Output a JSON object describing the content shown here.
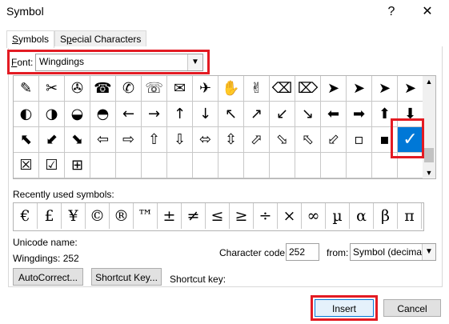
{
  "window": {
    "title": "Symbol",
    "help": "?",
    "close": "✕"
  },
  "tabs": [
    {
      "pre": "",
      "u": "S",
      "post": "ymbols"
    },
    {
      "pre": "S",
      "u": "p",
      "post": "ecial Characters"
    }
  ],
  "font": {
    "label_u": "F",
    "label_rest": "ont:",
    "value": "Wingdings"
  },
  "symbols": [
    [
      "✎",
      "✂",
      "✇",
      "☎",
      "✆",
      "☏",
      "✉",
      "✈",
      "✋",
      "✌",
      "⌫",
      "⌦",
      "➤",
      "➤",
      "➤",
      "➤"
    ],
    [
      "◐",
      "◑",
      "◒",
      "◓",
      "←",
      "→",
      "↑",
      "↓",
      "↖",
      "↗",
      "↙",
      "↘",
      "⬅",
      "➡",
      "⬆",
      "⬇"
    ],
    [
      "⬉",
      "⬋",
      "⬊",
      "⇦",
      "⇨",
      "⇧",
      "⇩",
      "⬄",
      "⇳",
      "⬀",
      "⬂",
      "⬁",
      "⬃",
      "▫",
      "▪",
      "✗"
    ],
    [
      "☒",
      "☑",
      "⊞",
      "",
      "",
      "",
      "",
      "",
      "",
      "",
      "",
      "",
      "",
      "",
      "",
      ""
    ]
  ],
  "selected_symbol": "✓",
  "recent_label": "Recently used symbols:",
  "recent": [
    "€",
    "£",
    "¥",
    "©",
    "®",
    "™",
    "±",
    "≠",
    "≤",
    "≥",
    "÷",
    "×",
    "∞",
    "µ",
    "α",
    "β",
    "π"
  ],
  "unicode_name_label": "Unicode name:",
  "unicode_value": "Wingdings: 252",
  "char_code_label": "Character code:",
  "char_code_value": "252",
  "from_label": "from:",
  "from_value": "Symbol (decimal)",
  "autocorrect_label": "AutoCorrect...",
  "shortcut_key_button": "Shortcut Key...",
  "shortcut_key_label": "Shortcut key:",
  "insert_label": "Insert",
  "cancel_label": "Cancel",
  "colors": {
    "highlight": "#e31b23",
    "selection": "#0078d7"
  }
}
